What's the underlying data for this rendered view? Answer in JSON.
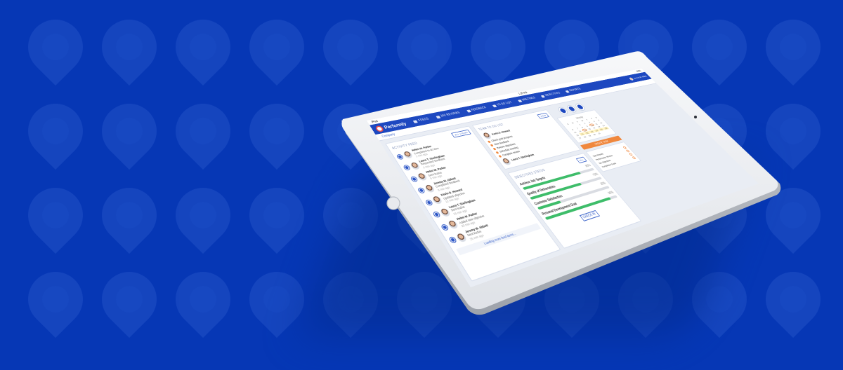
{
  "app": {
    "logo_text": "Performly",
    "status": {
      "carrier": "iPad",
      "time": "1:35 PM",
      "battery": "100%"
    }
  },
  "nav": {
    "items": [
      {
        "label": "Feeds",
        "icon": "feed-icon"
      },
      {
        "label": "360 Reviews",
        "icon": "review-icon"
      },
      {
        "label": "Feedback",
        "icon": "chat-icon"
      },
      {
        "label": "To Do List",
        "icon": "list-icon"
      },
      {
        "label": "Meetings",
        "icon": "people-icon"
      },
      {
        "label": "Objectives",
        "icon": "target-icon"
      },
      {
        "label": "Reports",
        "icon": "chart-icon"
      }
    ],
    "user_name": "Jeremy M. Abbott"
  },
  "subnav": {
    "label": "Company"
  },
  "activity_feed": {
    "title": "Activity Feed",
    "button": "All Items",
    "items": [
      {
        "name": "Helen M. Parker",
        "desc": "Completed to-do item",
        "time": "1 min ago"
      },
      {
        "name": "Laura T. Sterlingham",
        "desc": "Requested feedback",
        "time": "2 min ago"
      },
      {
        "name": "Helen M. Parker",
        "desc": "Sent kudos",
        "time": "5 min ago"
      },
      {
        "name": "Jeremy M. Abbott",
        "desc": "Completed feedback",
        "time": "8 min ago"
      },
      {
        "name": "Kevin D. Howard",
        "desc": "Updated objective",
        "time": "12 min ago"
      },
      {
        "name": "Laura T. Sterlingham",
        "desc": "Sent kudos",
        "time": "15 min ago"
      },
      {
        "name": "Helen M. Parker",
        "desc": "Added new objective",
        "time": "20 min ago"
      },
      {
        "name": "Jeremy M. Abbott",
        "desc": "Sent kudos",
        "time": "25 min ago"
      }
    ],
    "load_more": "Loading more feed items..."
  },
  "todo": {
    "title": "Team To Do List",
    "button": "View",
    "owner": "Kevin D. Howard",
    "items": [
      "Check goal progress",
      "Give feedback",
      "Review objectives",
      "Schedule meeting",
      "Complete review"
    ],
    "second_owner": "Laura T. Sterlingham"
  },
  "objectives": {
    "title": "Objectives Status",
    "button": "All",
    "items": [
      {
        "label": "Achieve Job Targets",
        "pct_text": "80%",
        "value": 0.8
      },
      {
        "label": "Quality of Deliverables",
        "pct_text": "70%",
        "value": 0.7
      },
      {
        "label": "Customer Satisfaction",
        "pct_text": "30%",
        "value": 0.3
      },
      {
        "label": "Personal Development Goal",
        "pct_text": "90%",
        "value": 0.9
      }
    ],
    "checkin": "Check In"
  },
  "sidebar": {
    "calendar_month": "January",
    "weekdays": [
      "S",
      "M",
      "T",
      "W",
      "T",
      "F",
      "S"
    ],
    "days": [
      "",
      "",
      "1",
      "2",
      "3",
      "4",
      "5",
      "6",
      "7",
      "8",
      "9",
      "10",
      "11",
      "12",
      "13",
      "14",
      "15",
      "16",
      "17",
      "18",
      "19",
      "20",
      "21",
      "22",
      "23",
      "24",
      "25",
      "26",
      "27",
      "28",
      "29",
      "30",
      "31",
      "",
      ""
    ],
    "create_button": "Create Task",
    "tasks": [
      "Task Results",
      "Performance Review",
      "Set Objectives",
      "Completed Goals"
    ]
  }
}
